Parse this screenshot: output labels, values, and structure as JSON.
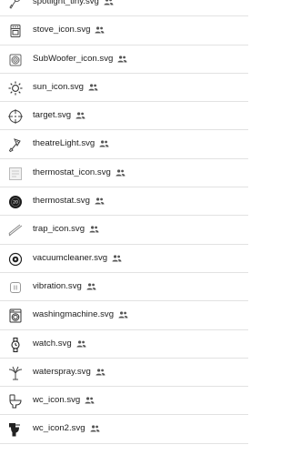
{
  "files": [
    {
      "name": "spotlight_tiny.svg",
      "icon": "spotlight-icon",
      "shared": "shared-icon"
    },
    {
      "name": "stove_icon.svg",
      "icon": "stove-icon",
      "shared": "shared-icon"
    },
    {
      "name": "SubWoofer_icon.svg",
      "icon": "subwoofer-icon",
      "shared": "shared-icon"
    },
    {
      "name": "sun_icon.svg",
      "icon": "sun-icon",
      "shared": "shared-icon"
    },
    {
      "name": "target.svg",
      "icon": "target-icon",
      "shared": "shared-icon"
    },
    {
      "name": "theatreLight.svg",
      "icon": "theatre-light-icon",
      "shared": "shared-icon"
    },
    {
      "name": "thermostat_icon.svg",
      "icon": "thermostat-panel-icon",
      "shared": "shared-icon"
    },
    {
      "name": "thermostat.svg",
      "icon": "thermostat-dial-icon",
      "shared": "shared-icon"
    },
    {
      "name": "trap_icon.svg",
      "icon": "trap-icon",
      "shared": "shared-icon"
    },
    {
      "name": "vacuumcleaner.svg",
      "icon": "vacuum-cleaner-icon",
      "shared": "shared-icon"
    },
    {
      "name": "vibration.svg",
      "icon": "vibration-icon",
      "shared": "shared-icon"
    },
    {
      "name": "washingmachine.svg",
      "icon": "washing-machine-icon",
      "shared": "shared-icon"
    },
    {
      "name": "watch.svg",
      "icon": "watch-icon",
      "shared": "shared-icon"
    },
    {
      "name": "waterspray.svg",
      "icon": "water-spray-icon",
      "shared": "shared-icon"
    },
    {
      "name": "wc_icon.svg",
      "icon": "wc-icon",
      "shared": "shared-icon"
    },
    {
      "name": "wc_icon2.svg",
      "icon": "wc-alt-icon",
      "shared": "shared-icon"
    }
  ]
}
